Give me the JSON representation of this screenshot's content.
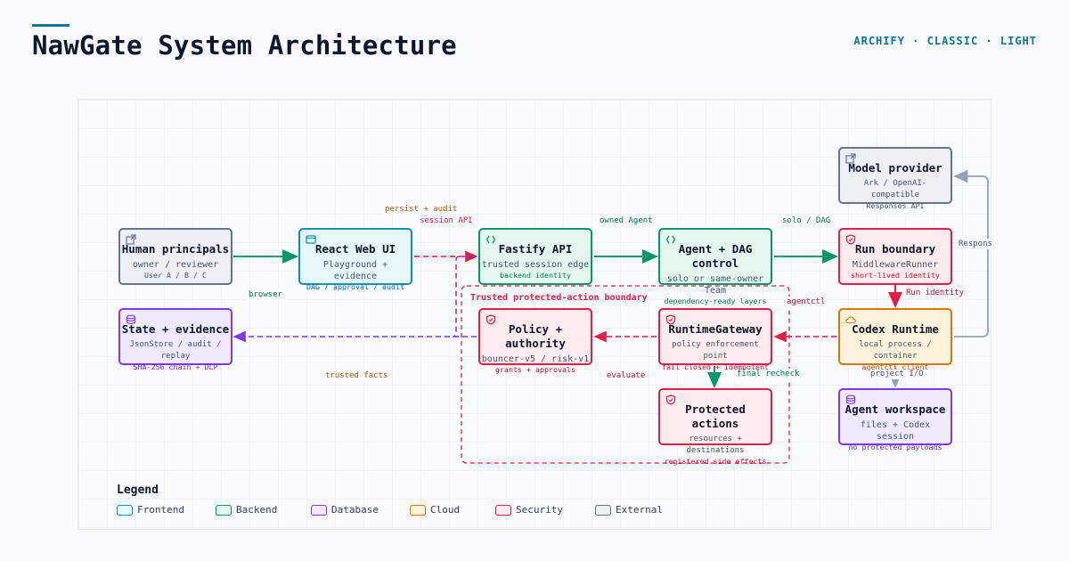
{
  "header": {
    "title": "NawGate System Architecture",
    "tagline": "ARCHIFY · CLASSIC · LIGHT"
  },
  "nodes": {
    "human": {
      "title": "Human principals",
      "sub": "owner / reviewer",
      "detail": "User A / B / C",
      "category": "External",
      "icon": "external-link-icon"
    },
    "react": {
      "title": "React Web UI",
      "sub": "Playground + evidence",
      "detail": "DAG / approval / audit",
      "category": "Frontend",
      "icon": "browser-window-icon"
    },
    "fastify": {
      "title": "Fastify API",
      "sub": "trusted session edge",
      "detail": "backend identity",
      "category": "Backend",
      "icon": "code-braces-icon"
    },
    "agent": {
      "title": "Agent + DAG control",
      "sub": "solo or same-owner Team",
      "detail": "dependency-ready layers",
      "category": "Backend",
      "icon": "code-braces-icon"
    },
    "run": {
      "title": "Run boundary",
      "sub": "MiddlewareRunner",
      "detail": "short-lived identity",
      "category": "Security",
      "icon": "shield-icon"
    },
    "model": {
      "title": "Model provider",
      "sub": "Ark / OpenAI-compatible",
      "detail": "Responses API",
      "category": "External",
      "icon": "external-link-icon"
    },
    "state": {
      "title": "State + evidence",
      "sub": "JsonStore / audit / replay",
      "detail": "SHA-256 chain + DLP",
      "category": "Database",
      "icon": "database-icon"
    },
    "policy": {
      "title": "Policy + authority",
      "sub": "bouncer-v5 / risk-v1",
      "detail": "grants + approvals",
      "category": "Security",
      "icon": "shield-icon"
    },
    "gateway": {
      "title": "RuntimeGateway",
      "sub": "policy enforcement point",
      "detail": "fail closed + idempotent",
      "category": "Security",
      "icon": "shield-icon"
    },
    "codex": {
      "title": "Codex Runtime",
      "sub": "local process / container",
      "detail": "agentctl client",
      "category": "Cloud",
      "icon": "cloud-icon"
    },
    "protected": {
      "title": "Protected actions",
      "sub": "resources + destinations",
      "detail": "registered side effects",
      "category": "Security",
      "icon": "shield-icon"
    },
    "workspace": {
      "title": "Agent workspace",
      "sub": "files + Codex session",
      "detail": "no protected payloads",
      "category": "Database",
      "icon": "database-icon"
    }
  },
  "edges": [
    {
      "from": "human",
      "to": "react",
      "label": "browser",
      "style": "solid",
      "color": "#059669"
    },
    {
      "from": "react",
      "to": "fastify",
      "label": "session API",
      "style": "dashed",
      "color": "#e11d48"
    },
    {
      "from": "fastify",
      "to": "agent",
      "label": "owned Agent",
      "style": "solid",
      "color": "#059669"
    },
    {
      "from": "agent",
      "to": "run",
      "label": "solo / DAG",
      "style": "solid",
      "color": "#059669"
    },
    {
      "from": "run",
      "to": "codex",
      "label": "Run identity",
      "style": "solid",
      "color": "#e11d48"
    },
    {
      "from": "codex",
      "to": "model",
      "label": "Responses API",
      "style": "solid",
      "color": "#94a3b8"
    },
    {
      "from": "codex",
      "to": "gateway",
      "label": "agentctl",
      "style": "dashed",
      "color": "#e11d48"
    },
    {
      "from": "gateway",
      "to": "policy",
      "label": "evaluate",
      "style": "dashed",
      "color": "#e11d48"
    },
    {
      "from": "gateway",
      "to": "protected",
      "label": "final recheck",
      "style": "solid",
      "color": "#059669"
    },
    {
      "from": "policy",
      "to": "state",
      "label": "trusted facts",
      "style": "dashed",
      "color": "#7c3aed"
    },
    {
      "from": "fastify",
      "to": "state",
      "label": "persist + audit",
      "style": "dashed",
      "color": "#7c3aed"
    },
    {
      "from": "codex",
      "to": "workspace",
      "label": "project I/O",
      "style": "solid",
      "color": "#94a3b8"
    }
  ],
  "edge_labels": {
    "persist": "persist + audit",
    "session": "session API",
    "owned": "owned Agent",
    "solo": "solo / DAG",
    "browser": "browser",
    "runid": "Run identity",
    "responses": "Respons",
    "agentctl": "agentctl",
    "evaluate": "evaluate",
    "recheck": "final recheck",
    "facts": "trusted facts",
    "projectio": "project I/O"
  },
  "edge_label_colors": {
    "persist": "#b45309",
    "session": "#e11d48",
    "owned": "#047857",
    "solo": "#047857",
    "browser": "#047857",
    "runid": "#be123c",
    "responses": "#475569",
    "agentctl": "#be123c",
    "evaluate": "#be123c",
    "recheck": "#047857",
    "facts": "#b45309",
    "projectio": "#475569"
  },
  "boundary": {
    "label": "Trusted protected-action boundary",
    "color": "#e11d48"
  },
  "legend": {
    "title": "Legend",
    "items": [
      {
        "label": "Frontend",
        "color": "#0891b2",
        "fill": "#e6f8fc"
      },
      {
        "label": "Backend",
        "color": "#059669",
        "fill": "#e3f7ee"
      },
      {
        "label": "Database",
        "color": "#7c3aed",
        "fill": "#efe9fd"
      },
      {
        "label": "Cloud",
        "color": "#d97706",
        "fill": "#fdf3dc"
      },
      {
        "label": "Security",
        "color": "#e11d48",
        "fill": "#fdecee"
      },
      {
        "label": "External",
        "color": "#64748b",
        "fill": "#eceff3"
      }
    ]
  }
}
